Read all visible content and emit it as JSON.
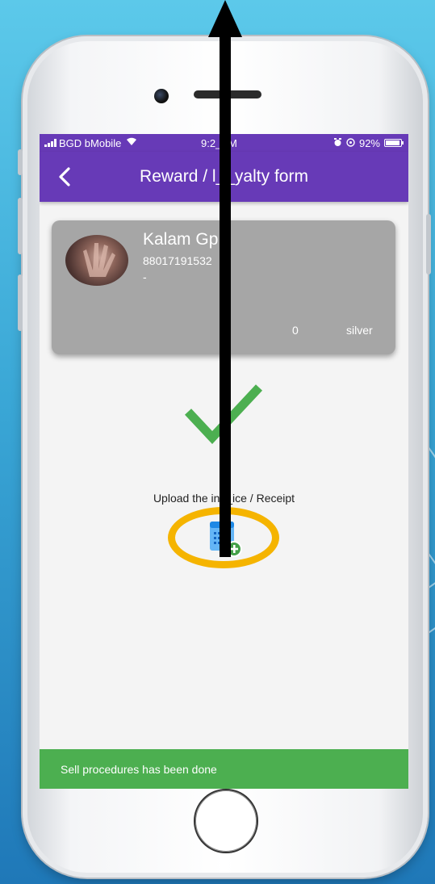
{
  "status_bar": {
    "carrier": "BGD bMobile",
    "time": "9:2_AM",
    "battery": "92%"
  },
  "app_bar": {
    "title": "Reward / l__yalty form"
  },
  "profile_card": {
    "name": "Kalam Gp",
    "phone": "88017191532",
    "email": "-",
    "points": "0",
    "tier": "silver"
  },
  "upload": {
    "label": "Upload the in__ice / Receipt"
  },
  "snackbar": {
    "message": "Sell procedures  has been done"
  },
  "colors": {
    "primary": "#673ab7",
    "success": "#4caf50",
    "card": "#a6a6a6",
    "highlight": "#f5b400"
  }
}
